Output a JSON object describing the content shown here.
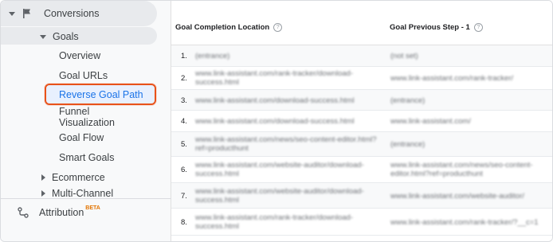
{
  "sidebar": {
    "conversions_label": "Conversions",
    "goals_label": "Goals",
    "items": [
      {
        "label": "Overview"
      },
      {
        "label": "Goal URLs"
      },
      {
        "label": "Reverse Goal Path"
      },
      {
        "label": "Funnel"
      },
      {
        "label": "Visualization"
      },
      {
        "label": "Goal Flow"
      },
      {
        "label": "Smart Goals"
      }
    ],
    "ecommerce_label": "Ecommerce",
    "multichannel_label": "Multi-Channel",
    "attribution_label": "Attribution",
    "attribution_badge": "BETA",
    "active_item": "Reverse Goal Path",
    "highlight_color": "#e8521a"
  },
  "table": {
    "columns": [
      {
        "label": "Goal Completion Location",
        "help": "?"
      },
      {
        "label": "Goal Previous Step - 1",
        "help": "?"
      }
    ],
    "rows": [
      {
        "index": "1.",
        "location": "(entrance)",
        "previous": "(not set)"
      },
      {
        "index": "2.",
        "location": "www.link-assistant.com/rank-tracker/download-success.html",
        "previous": "www.link-assistant.com/rank-tracker/"
      },
      {
        "index": "3.",
        "location": "www.link-assistant.com/download-success.html",
        "previous": "(entrance)"
      },
      {
        "index": "4.",
        "location": "www.link-assistant.com/download-success.html",
        "previous": "www.link-assistant.com/"
      },
      {
        "index": "5.",
        "location": "www.link-assistant.com/news/seo-content-editor.html?ref=producthunt",
        "previous": "(entrance)"
      },
      {
        "index": "6.",
        "location": "www.link-assistant.com/website-auditor/download-success.html",
        "previous": "www.link-assistant.com/news/seo-content-editor.html?ref=producthunt"
      },
      {
        "index": "7.",
        "location": "www.link-assistant.com/website-auditor/download-success.html",
        "previous": "www.link-assistant.com/website-auditor/"
      },
      {
        "index": "8.",
        "location": "www.link-assistant.com/rank-tracker/download-success.html",
        "previous": "www.link-assistant.com/rank-tracker/?__c=1"
      }
    ]
  }
}
